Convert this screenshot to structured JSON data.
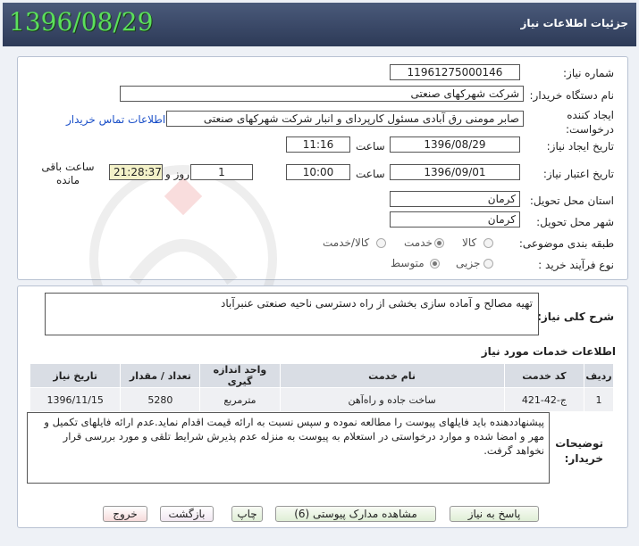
{
  "header": {
    "title": "جزئیات اطلاعات نیاز",
    "date_stamp": "1396/08/29"
  },
  "form": {
    "need_number_label": "شماره نیاز:",
    "need_number": "11961275000146",
    "buyer_org_label": "نام دستگاه خریدار:",
    "buyer_org": "شرکت شهرکهای صنعتی",
    "creator_label_line1": "ایجاد کننده",
    "creator_label_line2": "درخواست:",
    "creator": "صابر مومنی رق آبادی مسئول کارپردای و انبار شرکت شهرکهای صنعتی",
    "contact_link": "اطلاعات تماس خریدار",
    "created_date_label": "تاریخ ایجاد نیاز:",
    "created_date": "1396/08/29",
    "time_label": "ساعت",
    "created_time": "11:16",
    "valid_date_label": "تاریخ اعتبار نیاز:",
    "valid_date": "1396/09/01",
    "valid_time": "10:00",
    "days": "1",
    "days_label": "روز و",
    "remaining": "21:28:37",
    "remaining_label_line1": "ساعت باقی",
    "remaining_label_line2": "مانده",
    "province_label": "استان محل تحویل:",
    "province": "کرمان",
    "city_label": "شهر محل تحویل:",
    "city": "کرمان",
    "category_label": "طبقه بندی موضوعی:",
    "category_options": [
      "کالا",
      "خدمت",
      "کالا/خدمت"
    ],
    "category_selected": "خدمت",
    "process_label": "نوع فرآیند خرید :",
    "process_options": [
      "جزیی",
      "متوسط"
    ],
    "process_selected": "متوسط"
  },
  "description": {
    "label": "شرح کلی نیاز:",
    "text": "تهیه مصالح و آماده سازی بخشی از راه دسترسی ناحیه صنعتی عنبرآباد"
  },
  "services": {
    "title": "اطلاعات خدمات مورد نیاز",
    "columns": [
      "ردیف",
      "کد خدمت",
      "نام خدمت",
      "واحد اندازه گیری",
      "تعداد / مقدار",
      "تاریخ نیاز"
    ],
    "rows": [
      [
        "1",
        "ج-42-421",
        "ساخت جاده و راه‌آهن",
        "مترمربع",
        "5280",
        "1396/11/15"
      ]
    ]
  },
  "notes": {
    "label_line1": "توضیحات",
    "label_line2": "خریدار:",
    "text": "پیشنهاددهنده باید فایلهای پیوست را مطالعه نموده و سپس نسبت به ارائه قیمت اقدام نماید.عدم ارائه فایلهای تکمیل و مهر و امضا شده و موارد درخواستی در استعلام به پیوست به منزله عدم پذیرش شرایط تلقی و مورد بررسی قرار نخواهد گرفت."
  },
  "buttons": {
    "reply": "پاسخ به نیاز",
    "attachments": "مشاهده مدارک پیوستی (6)",
    "print": "چاپ",
    "back": "بازگشت",
    "exit": "خروج"
  },
  "colors": {
    "header_bg": "#2d3a57",
    "date_stamp": "#5be05b",
    "link": "#1a4fc8",
    "remaining_bg": "#f3f1c8"
  }
}
